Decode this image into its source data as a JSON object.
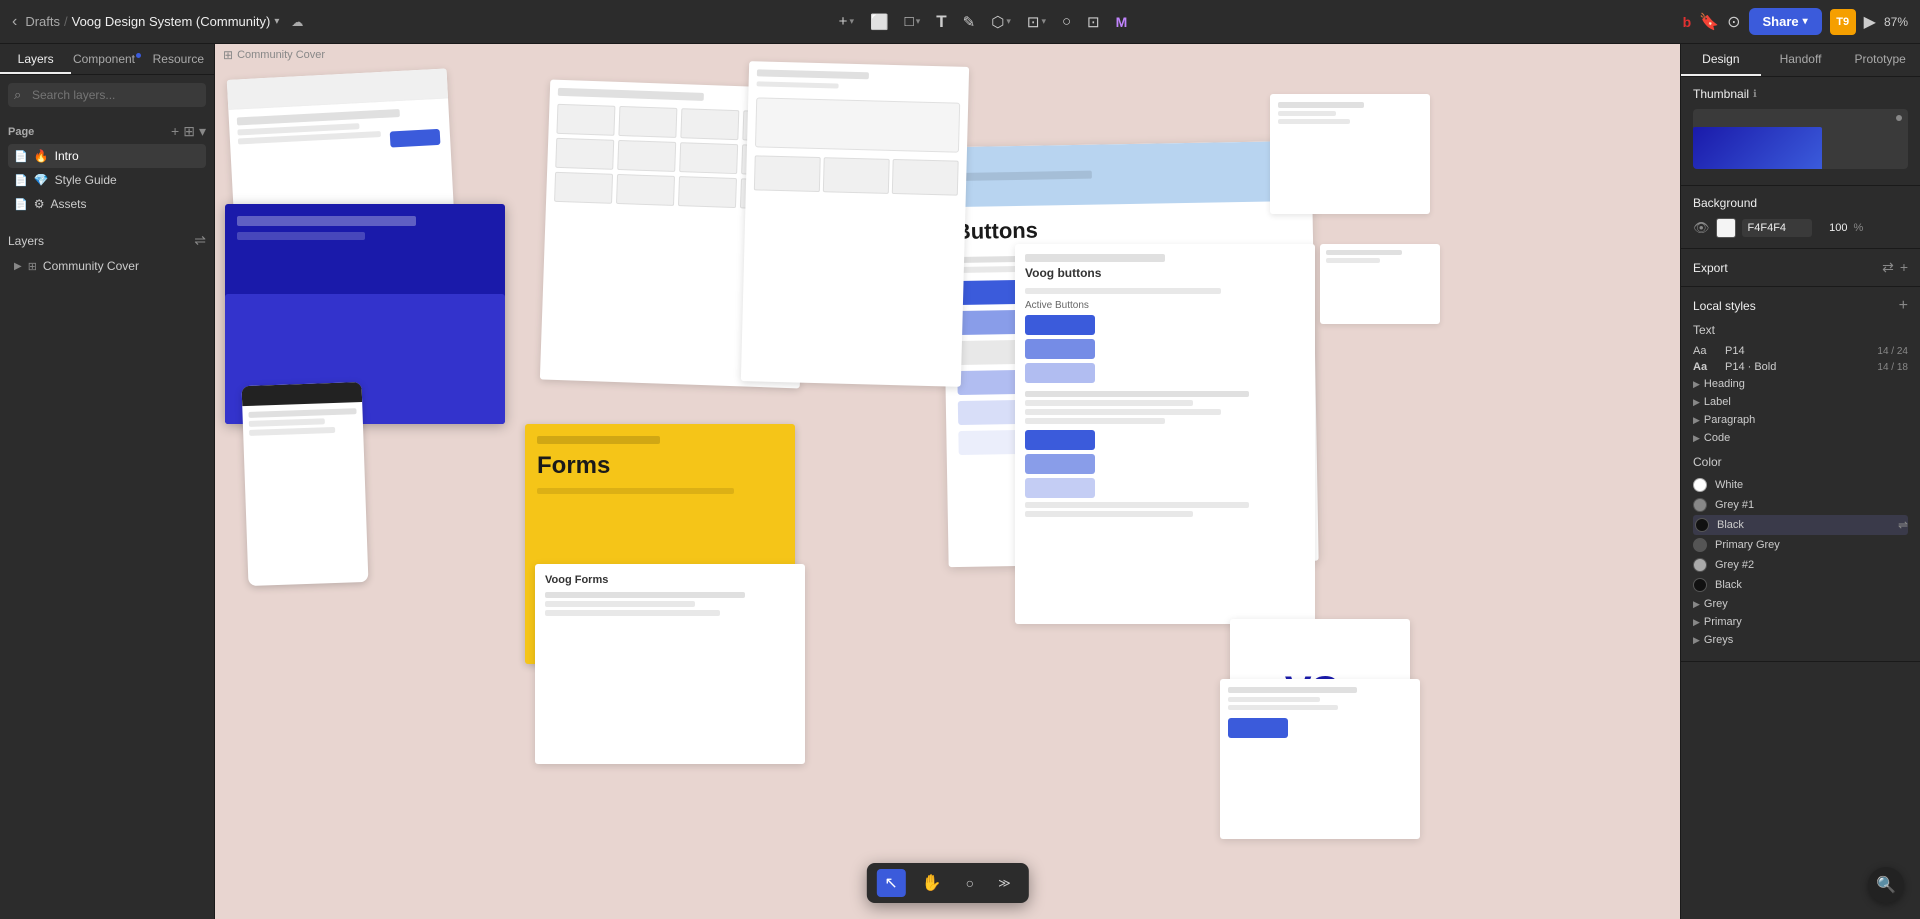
{
  "topbar": {
    "back_icon": "‹",
    "breadcrumb_root": "Drafts",
    "breadcrumb_sep": "/",
    "breadcrumb_current": "Voog Design System (Community)",
    "cloud_icon": "☁",
    "tools": [
      {
        "id": "add",
        "icon": "+",
        "has_arrow": true
      },
      {
        "id": "frame",
        "icon": "⬜",
        "has_arrow": false
      },
      {
        "id": "shape",
        "icon": "□",
        "has_arrow": true
      },
      {
        "id": "text",
        "icon": "T",
        "has_arrow": false
      },
      {
        "id": "pen",
        "icon": "✎",
        "has_arrow": false
      },
      {
        "id": "component",
        "icon": "⬡",
        "has_arrow": true
      },
      {
        "id": "mask",
        "icon": "⬤",
        "has_arrow": true
      },
      {
        "id": "ellipse",
        "icon": "○",
        "has_arrow": false
      },
      {
        "id": "crop",
        "icon": "⊡",
        "has_arrow": false
      },
      {
        "id": "plugin",
        "icon": "M",
        "has_arrow": false
      }
    ],
    "right_icons": [
      "b",
      "🔖",
      "⊙"
    ],
    "share_label": "Share",
    "user_initials": "T9",
    "play_icon": "▶",
    "zoom": "87%"
  },
  "left_panel": {
    "tabs": [
      {
        "id": "layers",
        "label": "Layers",
        "active": true,
        "has_dot": false
      },
      {
        "id": "component",
        "label": "Component",
        "active": false,
        "has_dot": true
      },
      {
        "id": "resource",
        "label": "Resource",
        "active": false,
        "has_dot": false
      }
    ],
    "search_placeholder": "Search layers...",
    "page_section": {
      "label": "Page",
      "pages": [
        {
          "id": "intro",
          "label": "Intro",
          "emoji": "🔥",
          "active": true
        },
        {
          "id": "style-guide",
          "label": "Style Guide",
          "emoji": "💎",
          "active": false
        },
        {
          "id": "assets",
          "label": "Assets",
          "emoji": "⚙",
          "active": false
        }
      ]
    },
    "layers_section": {
      "label": "Layers",
      "items": [
        {
          "id": "community-cover",
          "label": "Community Cover",
          "icon": "⊞",
          "expanded": false
        }
      ]
    }
  },
  "canvas": {
    "label": "Community Cover",
    "bg_color": "#e8d5d0"
  },
  "bottom_toolbar": {
    "tools": [
      {
        "id": "cursor",
        "icon": "↖",
        "active": true
      },
      {
        "id": "hand",
        "icon": "✋",
        "active": false
      },
      {
        "id": "comment",
        "icon": "○",
        "active": false
      },
      {
        "id": "flow",
        "icon": "≫",
        "active": false
      }
    ]
  },
  "right_panel": {
    "tabs": [
      {
        "id": "design",
        "label": "Design",
        "active": true
      },
      {
        "id": "handoff",
        "label": "Handoff",
        "active": false
      },
      {
        "id": "prototype",
        "label": "Prototype",
        "active": false
      }
    ],
    "thumbnail": {
      "label": "Thumbnail",
      "info_icon": "ℹ"
    },
    "background": {
      "label": "Background",
      "visible": true,
      "color": "#F4F4F4",
      "opacity": "100",
      "percent": "%"
    },
    "export": {
      "label": "Export",
      "icons": [
        "⇄",
        "+"
      ]
    },
    "local_styles": {
      "label": "Local styles",
      "add_icon": "+",
      "text_category": {
        "label": "Text",
        "items": [
          {
            "id": "p14",
            "preview": "Aa",
            "name": "P14",
            "meta": "14 / 24"
          },
          {
            "id": "p14-bold",
            "preview": "Aa",
            "name": "P14 · Bold",
            "meta": "14 / 18"
          }
        ],
        "groups": [
          {
            "id": "heading",
            "label": "Heading"
          },
          {
            "id": "label",
            "label": "Label"
          },
          {
            "id": "paragraph",
            "label": "Paragraph"
          },
          {
            "id": "code",
            "label": "Code"
          }
        ]
      },
      "color_category": {
        "label": "Color",
        "items": [
          {
            "id": "white",
            "name": "White",
            "color": "#ffffff",
            "is_outline": true
          },
          {
            "id": "grey1",
            "name": "Grey #1",
            "color": "#888888"
          },
          {
            "id": "black1",
            "name": "Black",
            "color": "#111111",
            "selected": true
          },
          {
            "id": "primary-grey",
            "name": "Primary Grey",
            "color": "#555555"
          },
          {
            "id": "grey2",
            "name": "Grey #2",
            "color": "#aaaaaa"
          },
          {
            "id": "black2",
            "name": "Black",
            "color": "#111111"
          }
        ],
        "groups": [
          {
            "id": "grey",
            "label": "Grey"
          },
          {
            "id": "primary",
            "label": "Primary"
          },
          {
            "id": "greys",
            "label": "Greys"
          }
        ]
      }
    }
  }
}
